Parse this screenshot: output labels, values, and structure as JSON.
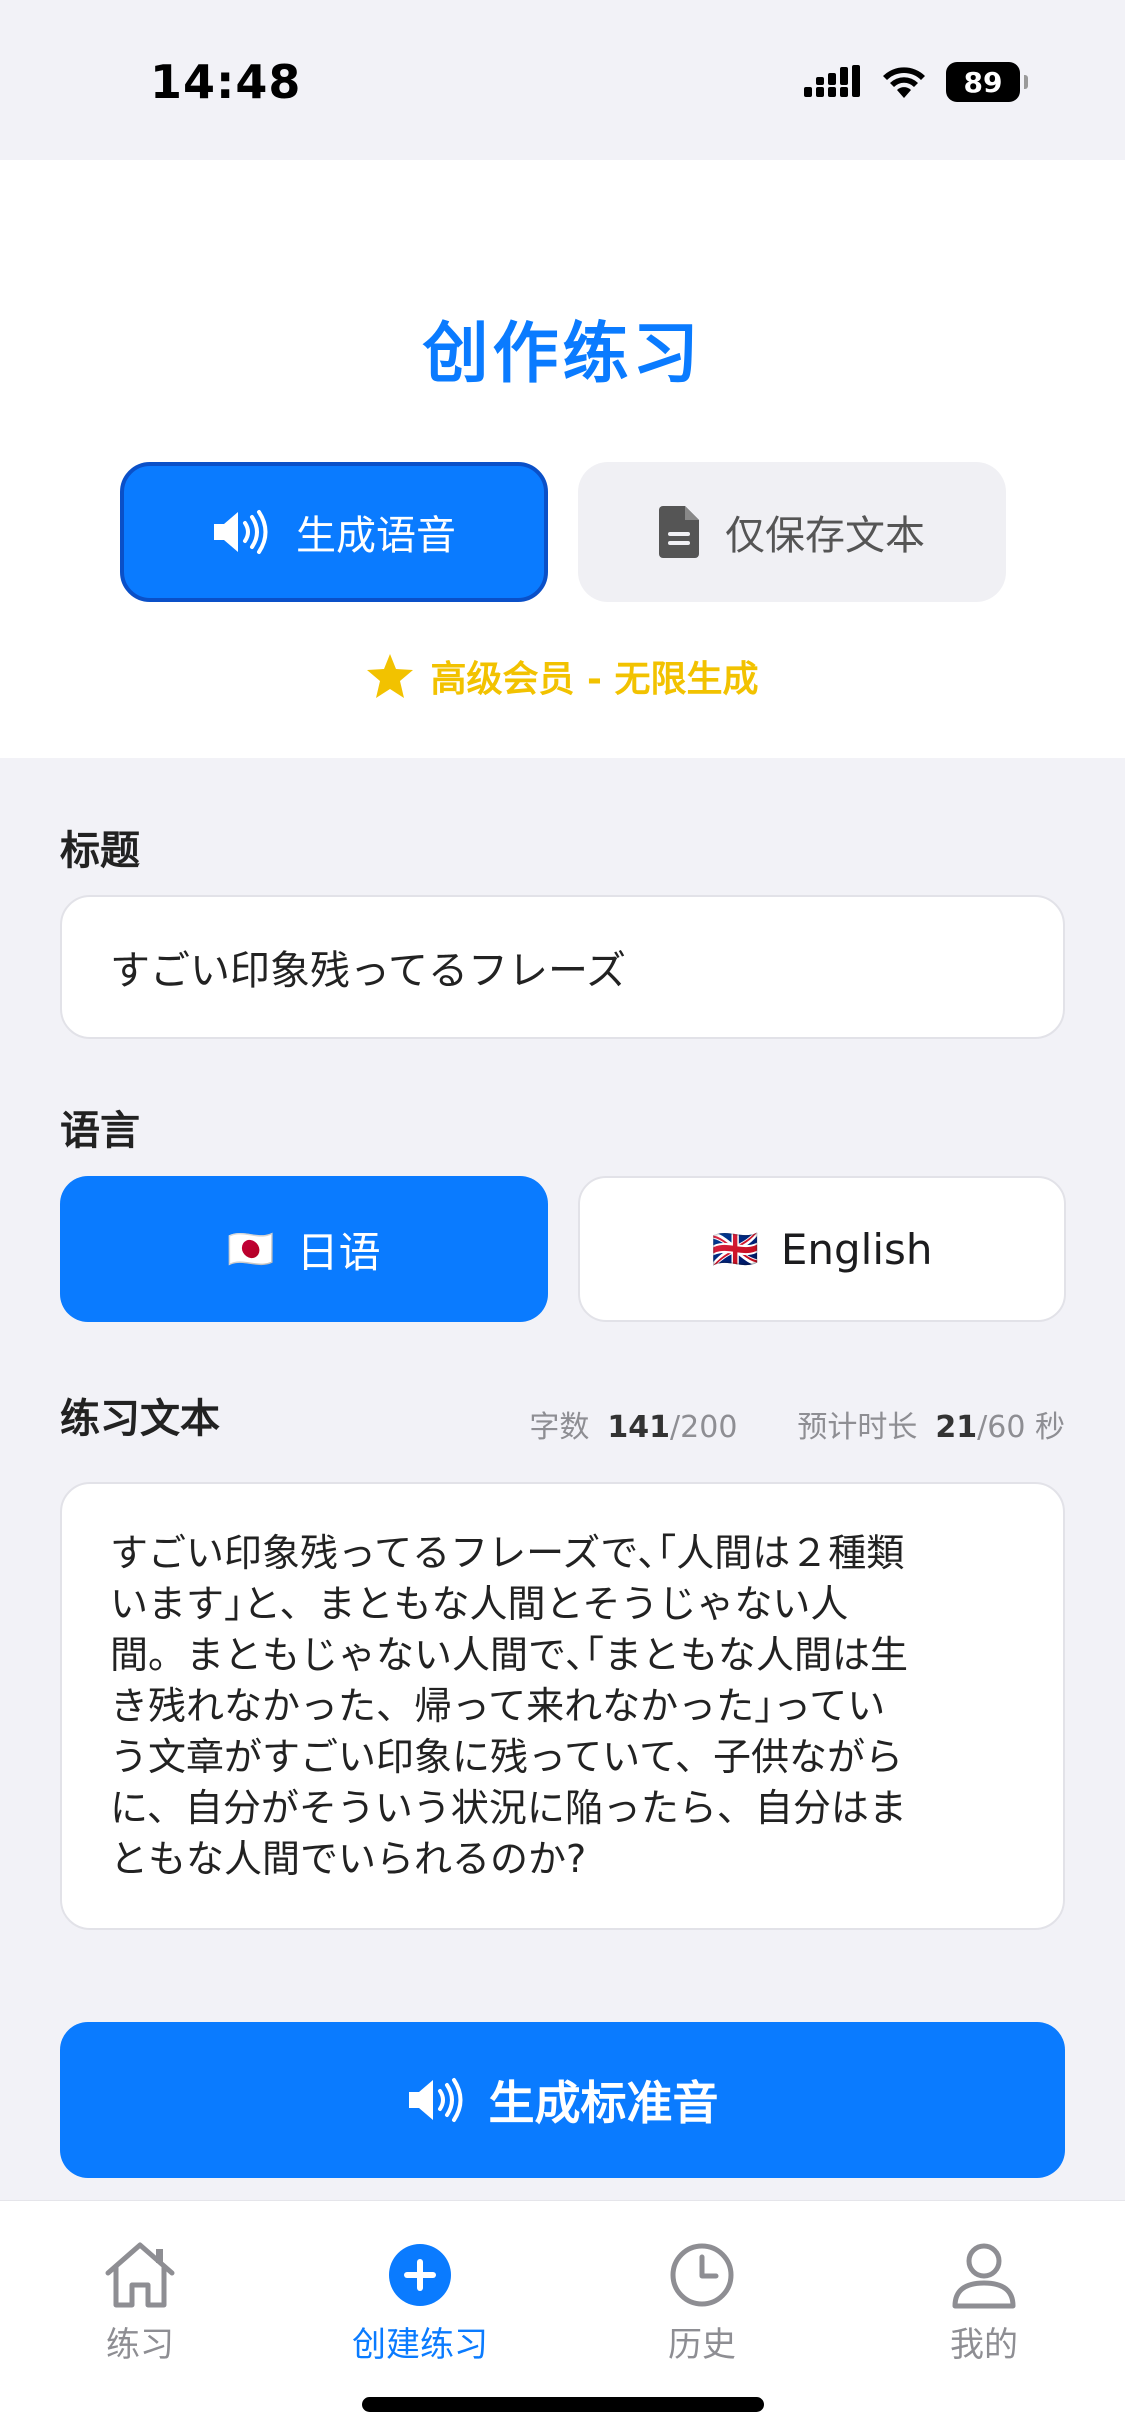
{
  "status_bar": {
    "time": "14:48",
    "battery": "89"
  },
  "header": {
    "title": "创作练习",
    "mode_audio_label": "生成语音",
    "mode_text_label": "仅保存文本",
    "premium_label": "高级会员 - 无限生成"
  },
  "form": {
    "title_label": "标题",
    "title_value": "すごい印象残ってるフレーズ",
    "language_label": "语言",
    "language_options": [
      {
        "flag": "🇯🇵",
        "label": "日语",
        "selected": true
      },
      {
        "flag": "🇬🇧",
        "label": "English",
        "selected": false
      }
    ],
    "text_label": "练习文本",
    "char_count_label": "字数",
    "char_count_value": "141",
    "char_count_max": "/200",
    "duration_label": "预计时长",
    "duration_value": "21",
    "duration_max": "/60 秒",
    "text_lines": [
      "すごい印象残ってるフレーズで､｢人間は２種類",
      "います｣と、まともな人間とそうじゃない人",
      "間。まともじゃない人間で､｢まともな人間は生",
      "き残れなかった、帰って来れなかった｣ってい",
      "う文章がすごい印象に残っていて、子供ながら",
      "に、自分がそういう状況に陥ったら、自分はま",
      "ともな人間でいられるのか?"
    ]
  },
  "generate_button_label": "生成标准音",
  "tab_bar": [
    {
      "label": "练习",
      "icon": "home-icon",
      "active": false
    },
    {
      "label": "创建练习",
      "icon": "plus-circle-icon",
      "active": true
    },
    {
      "label": "历史",
      "icon": "clock-icon",
      "active": false
    },
    {
      "label": "我的",
      "icon": "person-icon",
      "active": false
    }
  ],
  "colors": {
    "accent": "#0a7bff",
    "premium": "#f2c200"
  }
}
